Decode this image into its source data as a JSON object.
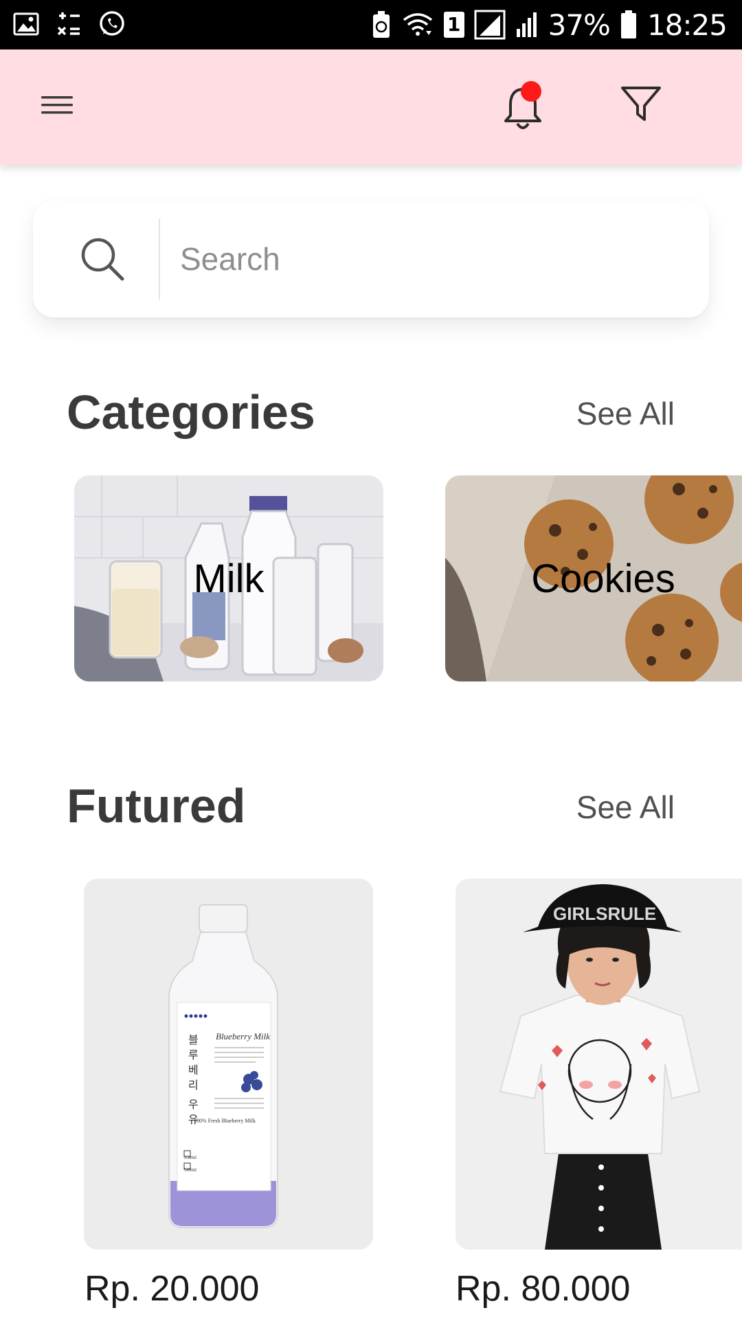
{
  "status_bar": {
    "battery": "37%",
    "time": "18:25",
    "sim_badge": "1"
  },
  "app_bar": {
    "menu_icon": "hamburger-menu-icon",
    "notification_icon": "bell-icon",
    "filter_icon": "filter-icon",
    "accent": "#ffdde2",
    "notification_dot_color": "#ff1a1a"
  },
  "search": {
    "placeholder": "Search",
    "value": ""
  },
  "categories": {
    "title": "Categories",
    "see_all": "See All",
    "items": [
      {
        "label": "Milk"
      },
      {
        "label": "Cookies"
      }
    ]
  },
  "featured": {
    "title": "Futured",
    "see_all": "See All",
    "items": [
      {
        "price": "Rp. 20.000",
        "label_title": "Blueberry Milk",
        "label_korean": "블루베리 우유",
        "label_tagline": "100% Fresh Blueberry Milk",
        "label_size_1": "350ml",
        "label_size_2": "500ml"
      },
      {
        "price": "Rp. 80.000",
        "hat_text": "GIRLSRULE"
      }
    ]
  }
}
